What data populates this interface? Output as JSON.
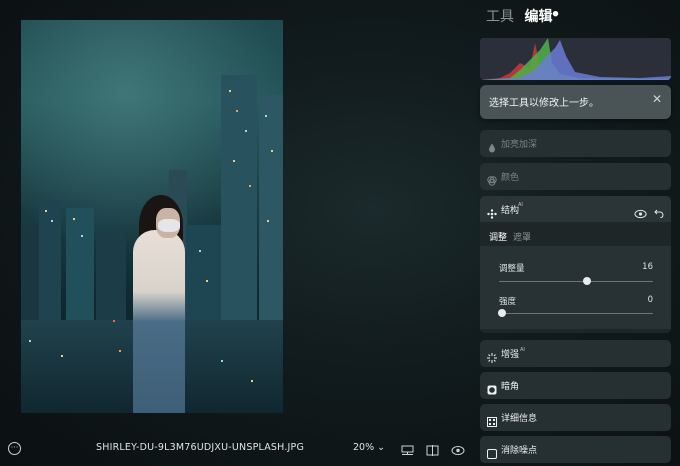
{
  "photo": {
    "filename": "SHIRLEY-DU-9L3M76UDJXU-UNSPLASH.JPG"
  },
  "bottom": {
    "zoom": "20%"
  },
  "tabs": {
    "tools": "工具",
    "edit": "编辑"
  },
  "tooltip": {
    "text": "选择工具以修改上一步。"
  },
  "rows": {
    "dodge_burn": "加亮加深",
    "color": "颜色",
    "structure": "结构",
    "enhance": "增强",
    "vignette": "暗角",
    "details": "详细信息",
    "denoise": "消除噪点"
  },
  "structure": {
    "ai_badge": "AI",
    "subtab_adjust": "调整",
    "subtab_mask": "遮罩",
    "slider1_label": "调整量",
    "slider1_value": "16",
    "slider2_label": "强度",
    "slider2_value": "0"
  },
  "enhance_badge": "AI"
}
